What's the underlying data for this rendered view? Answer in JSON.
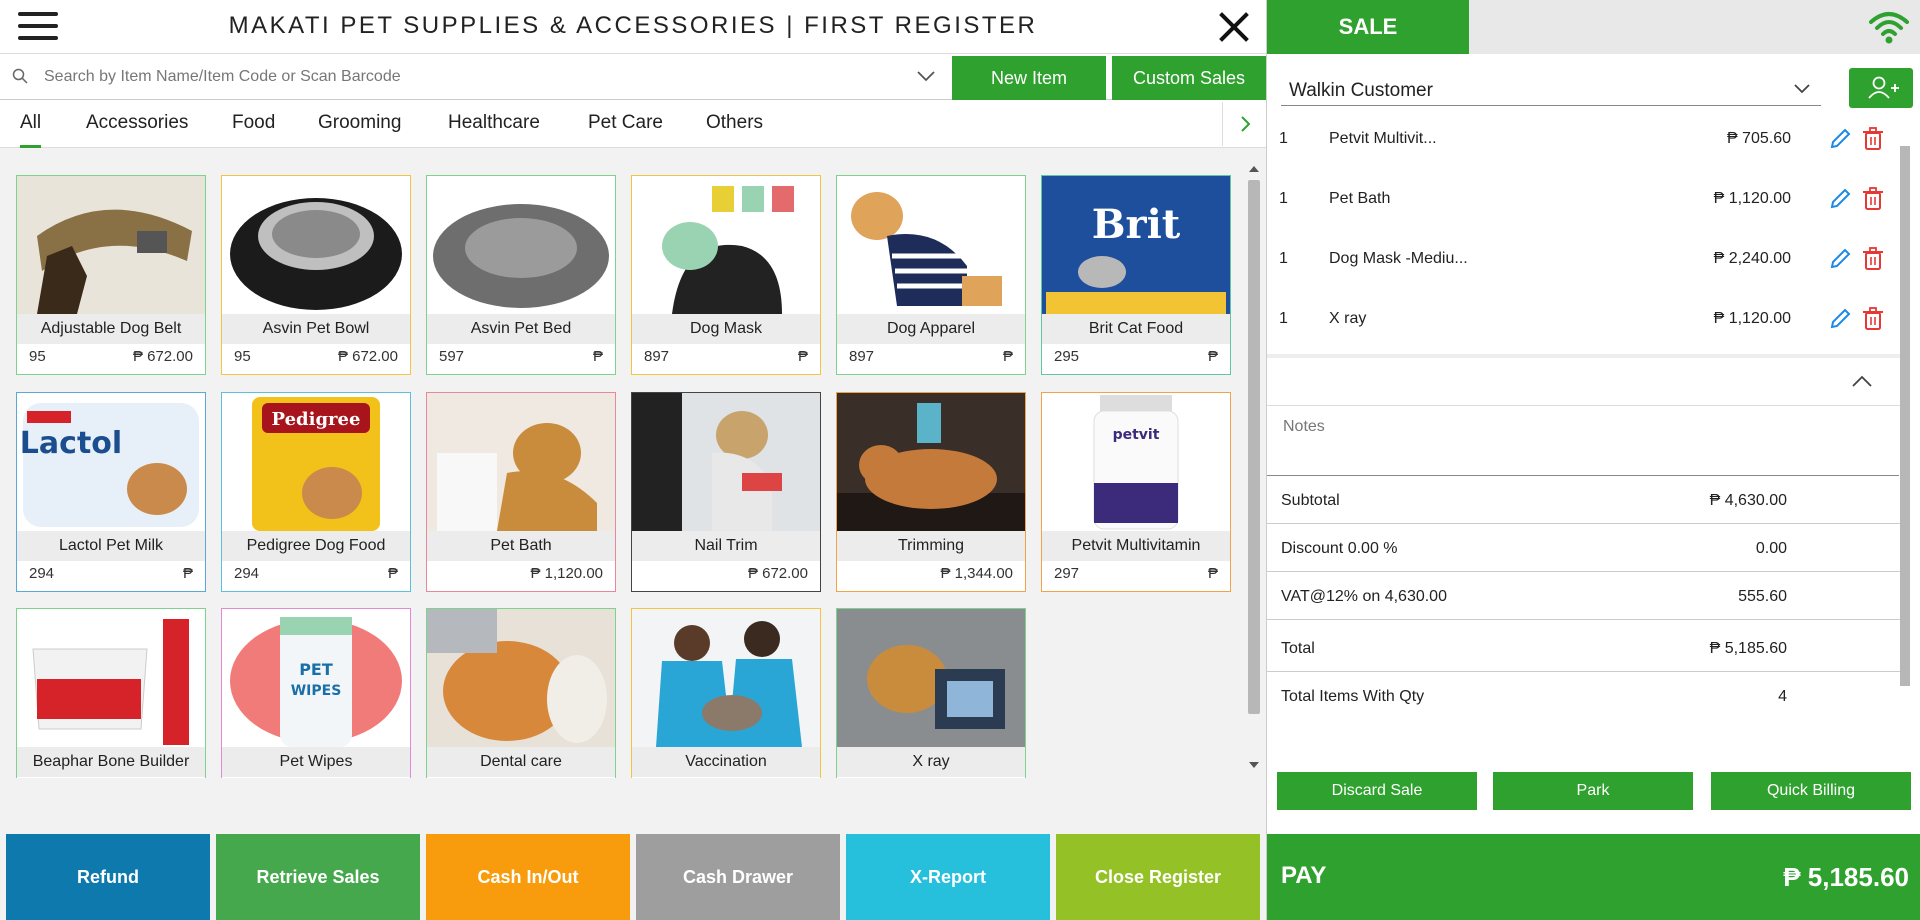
{
  "header": {
    "title": "MAKATI PET SUPPLIES & ACCESSORIES | FIRST REGISTER"
  },
  "search": {
    "placeholder": "Search by Item Name/Item Code or Scan Barcode"
  },
  "toolbar": {
    "new_item_label": "New Item",
    "custom_sales_label": "Custom Sales"
  },
  "categories": [
    "All",
    "Accessories",
    "Food",
    "Grooming",
    "Healthcare",
    "Pet Care",
    "Others"
  ],
  "products": [
    {
      "name": "Adjustable Dog Belt",
      "stock": "95",
      "price": "₱ 672.00",
      "border": "#7ed18f"
    },
    {
      "name": "Asvin Pet Bowl",
      "stock": "95",
      "price": "₱ 672.00",
      "border": "#f4c542"
    },
    {
      "name": "Asvin Pet Bed",
      "stock": "597",
      "price": "₱",
      "border": "#7ed18f"
    },
    {
      "name": "Dog Mask",
      "stock": "897",
      "price": "₱",
      "border": "#f4c542"
    },
    {
      "name": "Dog Apparel",
      "stock": "897",
      "price": "₱",
      "border": "#7ed18f"
    },
    {
      "name": "Brit Cat Food",
      "stock": "295",
      "price": "₱",
      "border": "#5fc6a6"
    },
    {
      "name": "Lactol Pet Milk",
      "stock": "294",
      "price": "₱",
      "border": "#5ba8d8"
    },
    {
      "name": "Pedigree Dog Food",
      "stock": "294",
      "price": "₱",
      "border": "#5bc0de"
    },
    {
      "name": "Pet Bath",
      "stock": "",
      "price": "₱ 1,120.00",
      "border": "#e8889b"
    },
    {
      "name": "Nail Trim",
      "stock": "",
      "price": "₱ 672.00",
      "border": "#444444"
    },
    {
      "name": "Trimming",
      "stock": "",
      "price": "₱ 1,344.00",
      "border": "#f0a34a"
    },
    {
      "name": "Petvit Multivitamin",
      "stock": "297",
      "price": "₱",
      "border": "#f0a34a"
    },
    {
      "name": "Beaphar Bone Builder",
      "stock": "",
      "price": "",
      "border": "#7ed18f"
    },
    {
      "name": "Pet Wipes",
      "stock": "",
      "price": "",
      "border": "#e08ad8"
    },
    {
      "name": "Dental care",
      "stock": "",
      "price": "",
      "border": "#7ed18f"
    },
    {
      "name": "Vaccination",
      "stock": "",
      "price": "",
      "border": "#f4c542"
    },
    {
      "name": "X ray",
      "stock": "",
      "price": "",
      "border": "#7ed18f"
    }
  ],
  "bottom_actions": [
    {
      "label": "Refund",
      "color": "#0e79ac"
    },
    {
      "label": "Retrieve Sales",
      "color": "#45a84c"
    },
    {
      "label": "Cash In/Out",
      "color": "#f89c0e"
    },
    {
      "label": "Cash Drawer",
      "color": "#9e9e9e"
    },
    {
      "label": "X-Report",
      "color": "#26c0dd"
    },
    {
      "label": "Close Register",
      "color": "#93c126"
    }
  ],
  "sale": {
    "tab_label": "SALE",
    "customer": "Walkin Customer",
    "lines": [
      {
        "qty": "1",
        "name": "Petvit Multivit...",
        "amount": "₱ 705.60"
      },
      {
        "qty": "1",
        "name": "Pet Bath",
        "amount": "₱ 1,120.00"
      },
      {
        "qty": "1",
        "name": "Dog Mask -Mediu...",
        "amount": "₱ 2,240.00"
      },
      {
        "qty": "1",
        "name": "X ray",
        "amount": "₱ 1,120.00"
      }
    ],
    "notes_placeholder": "Notes",
    "summary": [
      {
        "label": "Subtotal",
        "value": "₱ 4,630.00"
      },
      {
        "label": "Discount 0.00 %",
        "value": "0.00"
      },
      {
        "label": "VAT@12% on 4,630.00",
        "value": "555.60"
      },
      {
        "label": "Total",
        "value": "₱ 5,185.60"
      },
      {
        "label": "Total Items With Qty",
        "value": "4"
      }
    ],
    "actions": [
      "Discard Sale",
      "Park",
      "Quick Billing"
    ],
    "pay_label": "PAY",
    "pay_amount": "₱ 5,185.60"
  },
  "colors": {
    "accent": "#2fa12e",
    "edit_icon": "#1e88e5",
    "delete_icon": "#e53935"
  },
  "icons": [
    "menu-icon",
    "close-icon",
    "search-icon",
    "chevron-down-icon",
    "chevron-right-icon",
    "wifi-icon",
    "add-user-icon",
    "edit-icon",
    "delete-icon",
    "chevron-up-icon"
  ]
}
